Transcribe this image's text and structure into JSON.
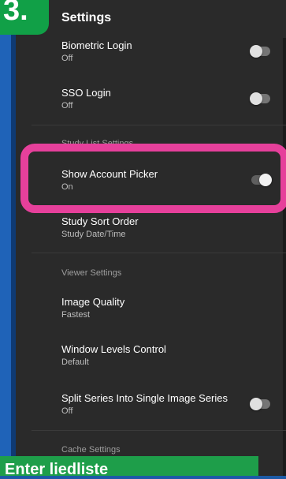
{
  "step_badge": "3.",
  "appbar": {
    "title": "Settings"
  },
  "settings": [
    {
      "title": "Biometric Login",
      "value": "Off"
    },
    {
      "title": "SSO Login",
      "value": "Off"
    },
    {
      "title": "Show Account Picker",
      "value": "On"
    },
    {
      "title": "Study Sort Order",
      "value": "Study Date/Time"
    },
    {
      "title": "Image Quality",
      "value": "Fastest"
    },
    {
      "title": "Window Levels Control",
      "value": "Default"
    },
    {
      "title": "Split Series Into Single Image Series",
      "value": "Off"
    }
  ],
  "sections": {
    "study_list": "Study List Settings",
    "viewer": "Viewer Settings",
    "cache": "Cache Settings"
  },
  "banner": "Enter liedliste",
  "colors": {
    "highlight": "#e6409b",
    "badge": "#11a047",
    "banner": "#1e9e4a"
  }
}
